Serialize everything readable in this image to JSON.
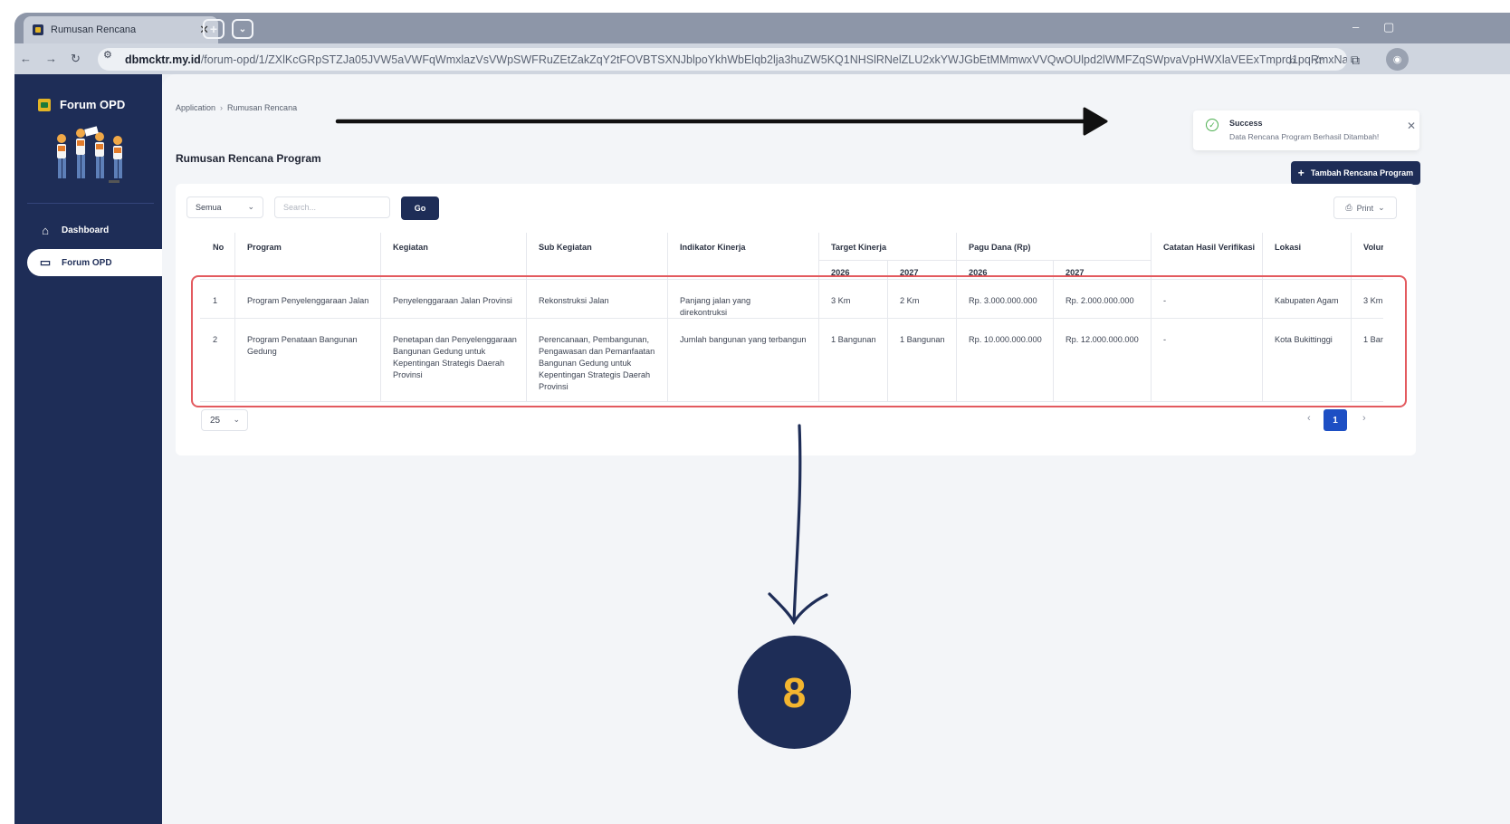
{
  "browser": {
    "tab_title": "Rumusan Rencana",
    "url_host": "dbmcktr.my.id",
    "url_path": "/forum-opd/1/ZXlKcGRpSTZJa05JVW5aVWFqWmxlazVsVWpSWFRuZEtZakZqY2tFOVBTSXNJblpoYkhWbElqb2lja3huZW5KQ1NHSlRNelZLU2xkYWJGbEtMMmwxVVQwOUlpd2lWMFZqSWpvaVpHWXlaVEExTmprd1pqRmxNamczTjJWaVkyUm..."
  },
  "sidebar": {
    "brand": "Forum OPD",
    "items": [
      {
        "label": "Dashboard",
        "icon": "home-icon"
      },
      {
        "label": "Forum OPD",
        "icon": "chat-icon"
      }
    ]
  },
  "breadcrumb": [
    "Application",
    "Rumusan Rencana"
  ],
  "page_title": "Rumusan Rencana Program",
  "add_button": "Tambah Rencana Program",
  "toolbar": {
    "filter_value": "Semua",
    "search_placeholder": "Search...",
    "go_label": "Go",
    "print_label": "Print"
  },
  "table": {
    "headers": {
      "no": "No",
      "program": "Program",
      "kegiatan": "Kegiatan",
      "sub_kegiatan": "Sub Kegiatan",
      "indikator": "Indikator Kinerja",
      "target": "Target Kinerja",
      "pagu": "Pagu Dana (Rp)",
      "catatan": "Catatan Hasil Verifikasi",
      "lokasi": "Lokasi",
      "volume": "Volur",
      "year_a": "2026",
      "year_b": "2027"
    },
    "rows": [
      {
        "no": "1",
        "program": "Program Penyelenggaraan Jalan",
        "kegiatan": "Penyelenggaraan Jalan Provinsi",
        "sub_kegiatan": "Rekonstruksi Jalan",
        "indikator": "Panjang jalan yang direkontruksi",
        "target_2026": "3 Km",
        "target_2027": "2 Km",
        "pagu_2026": "Rp. 3.000.000.000",
        "pagu_2027": "Rp. 2.000.000.000",
        "catatan": "-",
        "lokasi": "Kabupaten Agam",
        "volume": "3 Km"
      },
      {
        "no": "2",
        "program": "Program Penataan Bangunan Gedung",
        "kegiatan": "Penetapan dan Penyelenggaraan Bangunan Gedung untuk Kepentingan Strategis Daerah Provinsi",
        "sub_kegiatan": "Perencanaan, Pembangunan, Pengawasan dan Pemanfaatan Bangunan Gedung untuk Kepentingan Strategis Daerah Provinsi",
        "indikator": "Jumlah bangunan yang terbangun",
        "target_2026": "1 Bangunan",
        "target_2027": "1 Bangunan",
        "pagu_2026": "Rp. 10.000.000.000",
        "pagu_2027": "Rp. 12.000.000.000",
        "catatan": "-",
        "lokasi": "Kota Bukittinggi",
        "volume": "1 Bar"
      }
    ]
  },
  "pagination": {
    "page_size": "25",
    "current_page": "1",
    "prev": "‹",
    "next": "›"
  },
  "toast": {
    "title": "Success",
    "message": "Data Rencana Program Berhasil Ditambah!"
  },
  "annotation": {
    "step_number": "8"
  },
  "colors": {
    "navy": "#1e2d57",
    "accent_blue": "#1d4fc4",
    "highlight_red": "#e35a5f",
    "badge_text": "#f3b52f",
    "success_green": "#4caf50"
  }
}
